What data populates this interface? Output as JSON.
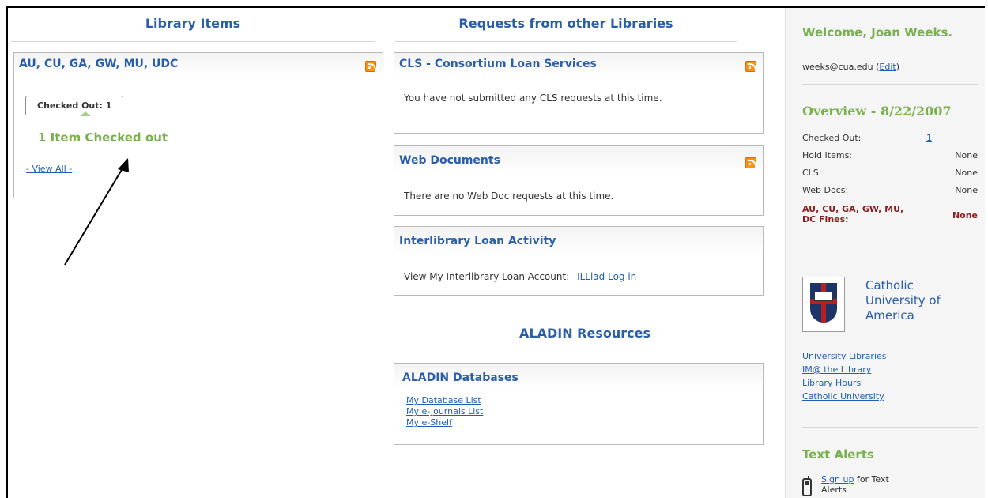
{
  "library_items": {
    "heading": "Library Items",
    "panel_title": "AU, CU, GA, GW, MU, UDC",
    "tab_label": "Checked Out: 1",
    "status": "1 Item Checked out",
    "view_all": "- View All -"
  },
  "requests": {
    "heading": "Requests from other Libraries",
    "cls": {
      "title": "CLS - Consortium Loan Services",
      "body": "You have not submitted any CLS requests at this time."
    },
    "web_docs": {
      "title": "Web Documents",
      "body": "There are no Web Doc requests at this time."
    },
    "ill": {
      "title": "Interlibrary Loan Activity",
      "body_label": "View My Interlibrary Loan Account:",
      "link": "ILLiad Log in"
    }
  },
  "aladin": {
    "heading": "ALADIN Resources",
    "panel_title": "ALADIN Databases",
    "links": [
      "My Database List",
      "My e-Journals List",
      "My e-Shelf"
    ]
  },
  "sidebar": {
    "welcome": "Welcome, Joan Weeks.",
    "email": "weeks@cua.edu",
    "edit_label": "Edit",
    "overview_title": "Overview - 8/22/2007",
    "overview": [
      {
        "label": "Checked Out:",
        "value": "1"
      },
      {
        "label": "Hold Items:",
        "value": "None"
      },
      {
        "label": "CLS:",
        "value": "None"
      },
      {
        "label": "Web Docs:",
        "value": "None"
      }
    ],
    "fines_label": "AU, CU, GA, GW, MU, DC Fines:",
    "fines_value": "None",
    "institution": "Catholic University of America",
    "links": [
      "University Libraries",
      "IM@ the Library",
      "Library Hours",
      "Catholic University"
    ],
    "text_alerts_title": "Text Alerts",
    "signup_link": "Sign up",
    "signup_rest": "for Text Alerts"
  },
  "colors": {
    "heading_blue": "#2a5ea8",
    "accent_green": "#7ab04f",
    "fines_red": "#8b1f1f",
    "rss_orange": "#f7931e"
  },
  "icons": [
    "rss-feed-icon",
    "cua-shield-logo",
    "mobile-phone-icon",
    "annotation-arrow"
  ]
}
